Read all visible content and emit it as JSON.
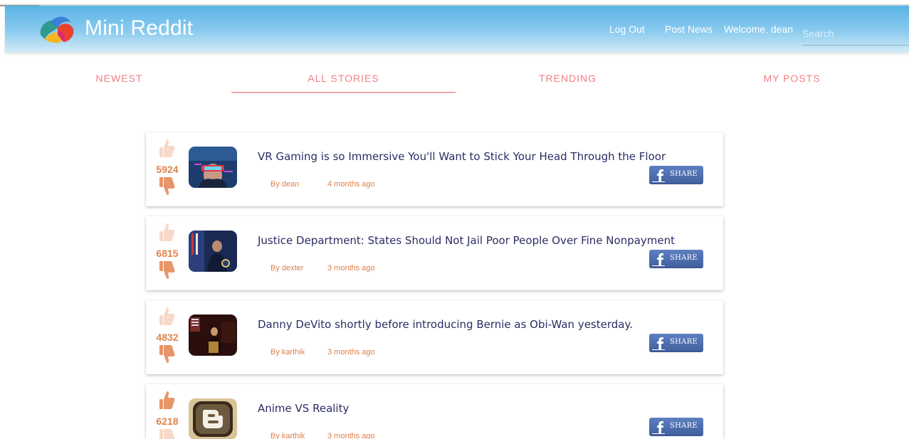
{
  "header": {
    "brand": "Mini Reddit",
    "logout": "Log Out",
    "post_news": "Post News",
    "welcome": "Welcome, dean",
    "search_placeholder": "Search"
  },
  "tabs": [
    {
      "label": "NEWEST",
      "active": false
    },
    {
      "label": "ALL STORIES",
      "active": true
    },
    {
      "label": "TRENDING",
      "active": false
    },
    {
      "label": "MY POSTS",
      "active": false
    }
  ],
  "posts": [
    {
      "score": "5924",
      "title": "VR Gaming is so Immersive You'll Want to Stick Your Head Through the Floor",
      "author": "By dean",
      "time": "4 months ago",
      "share": "SHARE",
      "thumb_icon": "vr-headset-photo"
    },
    {
      "score": "6815",
      "title": "Justice Department: States Should Not Jail Poor People Over Fine Nonpayment",
      "author": "By dexter",
      "time": "3 months ago",
      "share": "SHARE",
      "thumb_icon": "podium-speaker-photo"
    },
    {
      "score": "4832",
      "title": "Danny DeVito shortly before introducing Bernie as Obi-Wan yesterday.",
      "author": "By karthik",
      "time": "3 months ago",
      "share": "SHARE",
      "thumb_icon": "stage-speaker-photo"
    },
    {
      "score": "6218",
      "title": "Anime VS Reality",
      "author": "By karthik",
      "time": "3 months ago",
      "share": "SHARE",
      "thumb_icon": "blogger-logo"
    }
  ],
  "colors": {
    "navbar_top": "#59b3e5",
    "tab_text": "#ef7f85",
    "vote_score": "#e0844c",
    "title_text": "#2a2d63",
    "share_button": "#4a6aab"
  }
}
